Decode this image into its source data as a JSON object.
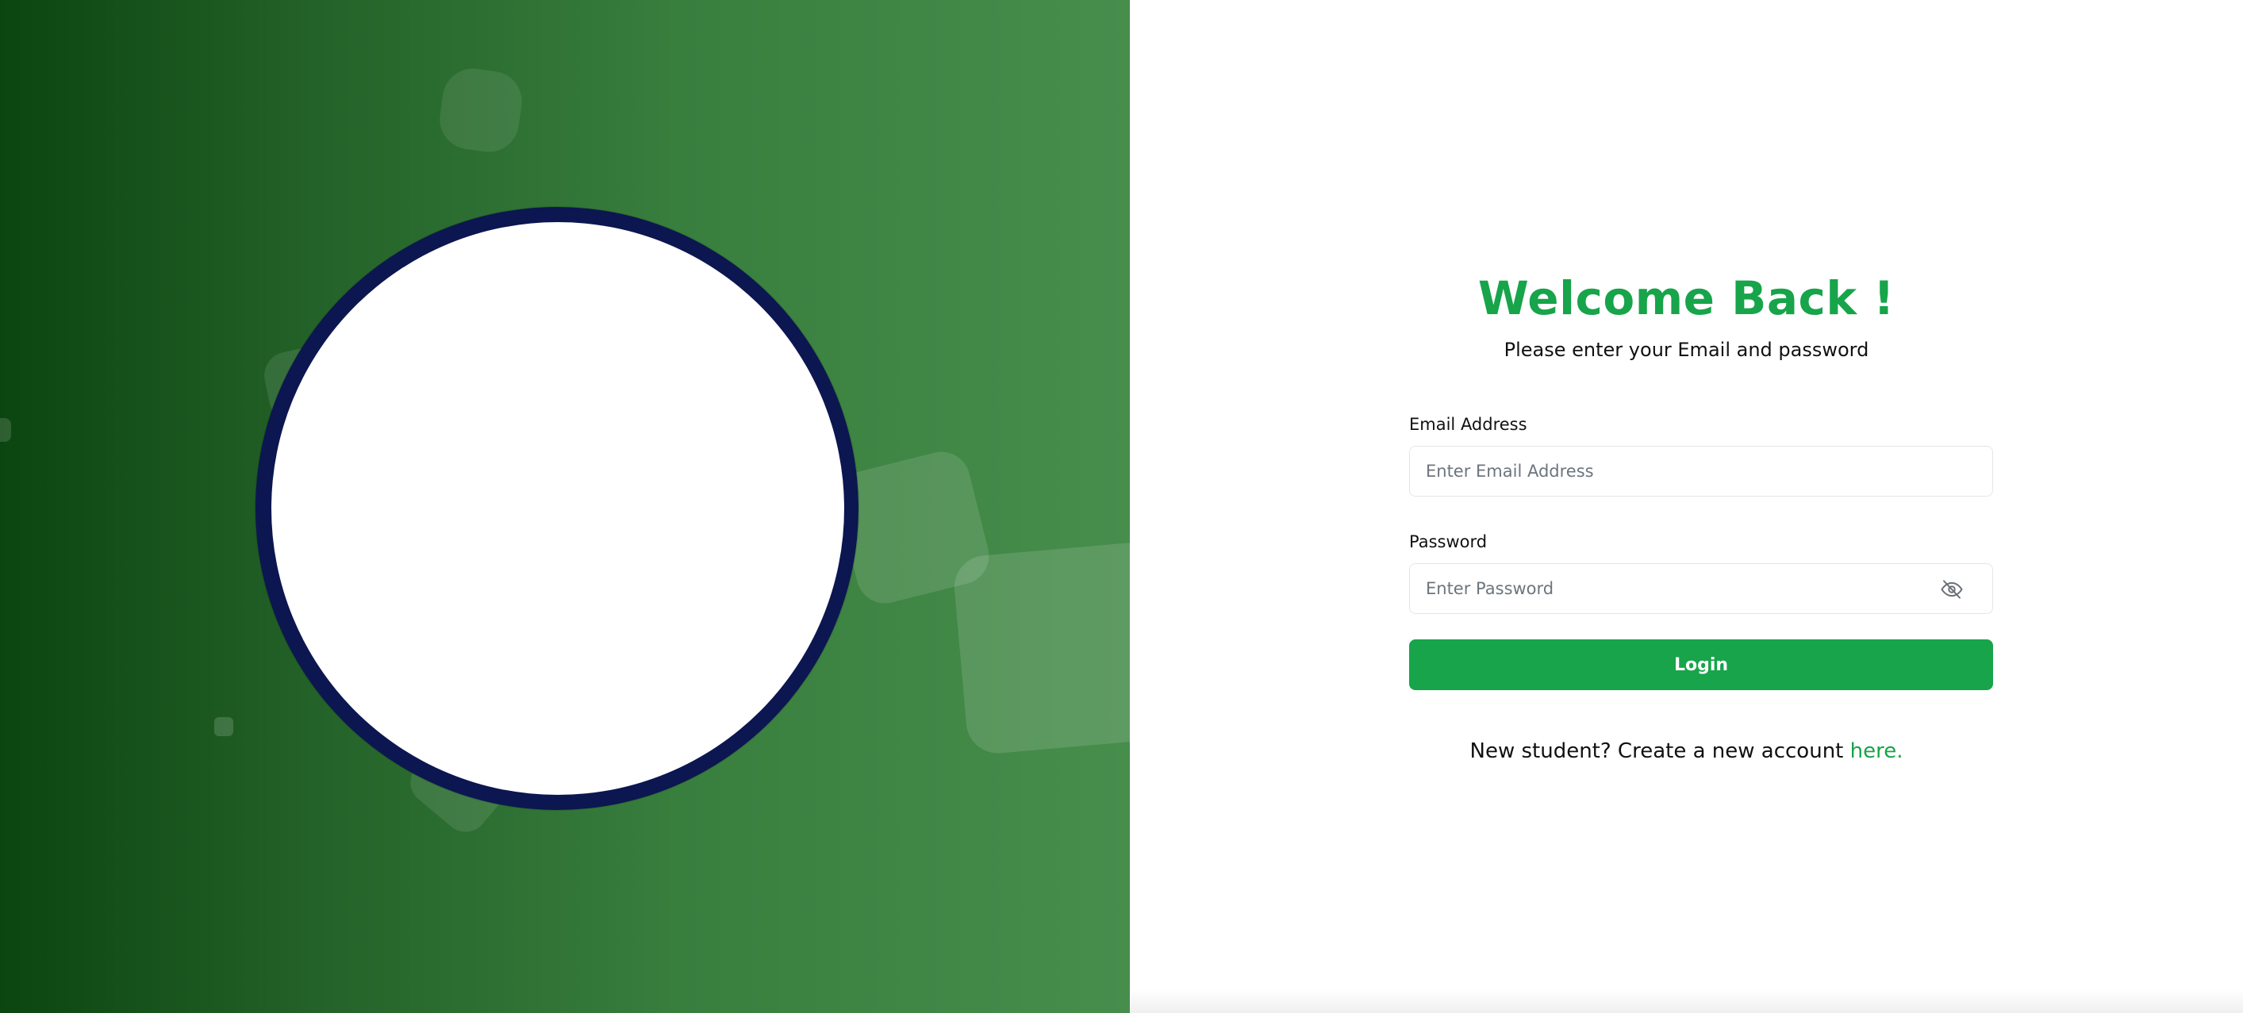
{
  "colors": {
    "brand_green": "#17a44a",
    "panel_green_dark": "#0b4510",
    "panel_green_light": "#478d4c",
    "logo_ring": "#0c1650"
  },
  "left_panel": {
    "logo": "circular-logo-placeholder"
  },
  "header": {
    "title": "Welcome Back !",
    "subtitle": "Please enter your Email and password"
  },
  "form": {
    "email": {
      "label": "Email Address",
      "placeholder": "Enter Email Address",
      "value": ""
    },
    "password": {
      "label": "Password",
      "placeholder": "Enter Password",
      "value": "",
      "toggle_icon": "eye-off-icon"
    },
    "login_label": "Login"
  },
  "signup": {
    "prompt": "New student? Create a new account ",
    "link_text": "here."
  }
}
